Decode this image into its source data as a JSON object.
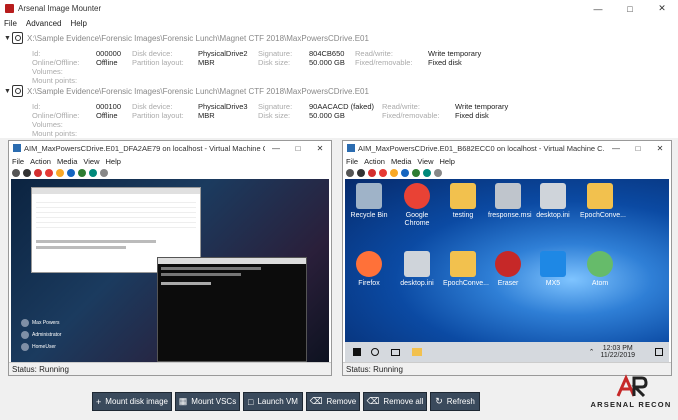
{
  "window": {
    "title": "Arsenal Image Mounter"
  },
  "menu": [
    "File",
    "Advanced",
    "Help"
  ],
  "disks": [
    {
      "path": "X:\\Sample Evidence\\Forensic Images\\Forensic Lunch\\Magnet CTF 2018\\MaxPowersCDrive.E01",
      "labels": {
        "id": "Id:",
        "online": "Online/Offline:",
        "volumes": "Volumes:",
        "mount": "Mount points:",
        "device": "Disk device:",
        "partition": "Partition layout:",
        "signature": "Signature:",
        "size": "Disk size:",
        "rw": "Read/write:",
        "fixed": "Fixed/removable:"
      },
      "id": "000000",
      "online": "Offline",
      "device": "PhysicalDrive2",
      "partition": "MBR",
      "signature": "804CB650",
      "size": "50.000 GB",
      "rw": "Write temporary",
      "fixed": "Fixed disk"
    },
    {
      "path": "X:\\Sample Evidence\\Forensic Images\\Forensic Lunch\\Magnet CTF 2018\\MaxPowersCDrive.E01",
      "labels": {
        "id": "Id:",
        "online": "Online/Offline:",
        "volumes": "Volumes:",
        "mount": "Mount points:",
        "device": "Disk device:",
        "partition": "Partition layout:",
        "signature": "Signature:",
        "size": "Disk size:",
        "rw": "Read/write:",
        "fixed": "Fixed/removable:"
      },
      "id": "000100",
      "online": "Offline",
      "device": "PhysicalDrive3",
      "partition": "MBR",
      "signature": "90AACACD (faked)",
      "size": "50.000 GB",
      "rw": "Write temporary",
      "fixed": "Fixed disk"
    }
  ],
  "vm_left": {
    "title": "AIM_MaxPowersCDrive.E01_DFA2AE79 on localhost - Virtual Machine C...",
    "menu": [
      "File",
      "Action",
      "Media",
      "View",
      "Help"
    ],
    "status": "Status: Running",
    "users": [
      "Max Powers",
      "Administrator",
      "HomeUser"
    ]
  },
  "vm_right": {
    "title": "AIM_MaxPowersCDrive.E01_B682ECC0 on localhost - Virtual Machine C...",
    "menu": [
      "File",
      "Action",
      "Media",
      "View",
      "Help"
    ],
    "status": "Status: Running",
    "icons": [
      {
        "label": "Recycle Bin",
        "name": "recycle-bin-icon",
        "color": "#9fb3c8"
      },
      {
        "label": "Google Chrome",
        "name": "chrome-icon",
        "color": "#e94235"
      },
      {
        "label": "testing",
        "name": "folder-icon",
        "color": "#f2c14e"
      },
      {
        "label": "fresponse.msi",
        "name": "msi-icon",
        "color": "#bfc5cc"
      },
      {
        "label": "desktop.ini",
        "name": "ini-icon",
        "color": "#cfd4da"
      },
      {
        "label": "EpochConve...",
        "name": "zip-folder-icon",
        "color": "#f2c14e"
      },
      {
        "label": "Firefox",
        "name": "firefox-icon",
        "color": "#ff7139"
      },
      {
        "label": "desktop.ini",
        "name": "ini-icon",
        "color": "#cfd4da"
      },
      {
        "label": "EpochConve...",
        "name": "excel-icon",
        "color": "#f2c14e"
      },
      {
        "label": "Eraser",
        "name": "eraser-icon",
        "color": "#c62828"
      },
      {
        "label": "MX5",
        "name": "mx5-icon",
        "color": "#1e88e5"
      },
      {
        "label": "Atom",
        "name": "atom-icon",
        "color": "#66bb6a"
      }
    ],
    "clock_time": "12:03 PM",
    "clock_date": "11/22/2019"
  },
  "buttons": [
    {
      "label": "Mount disk image",
      "icon": "plus-icon"
    },
    {
      "label": "Mount VSCs",
      "icon": "vsc-icon"
    },
    {
      "label": "Launch VM",
      "icon": "vm-icon"
    },
    {
      "label": "Remove",
      "icon": "remove-icon"
    },
    {
      "label": "Remove all",
      "icon": "remove-all-icon"
    },
    {
      "label": "Refresh",
      "icon": "refresh-icon"
    }
  ],
  "logo_text": "ARSENAL RECON"
}
